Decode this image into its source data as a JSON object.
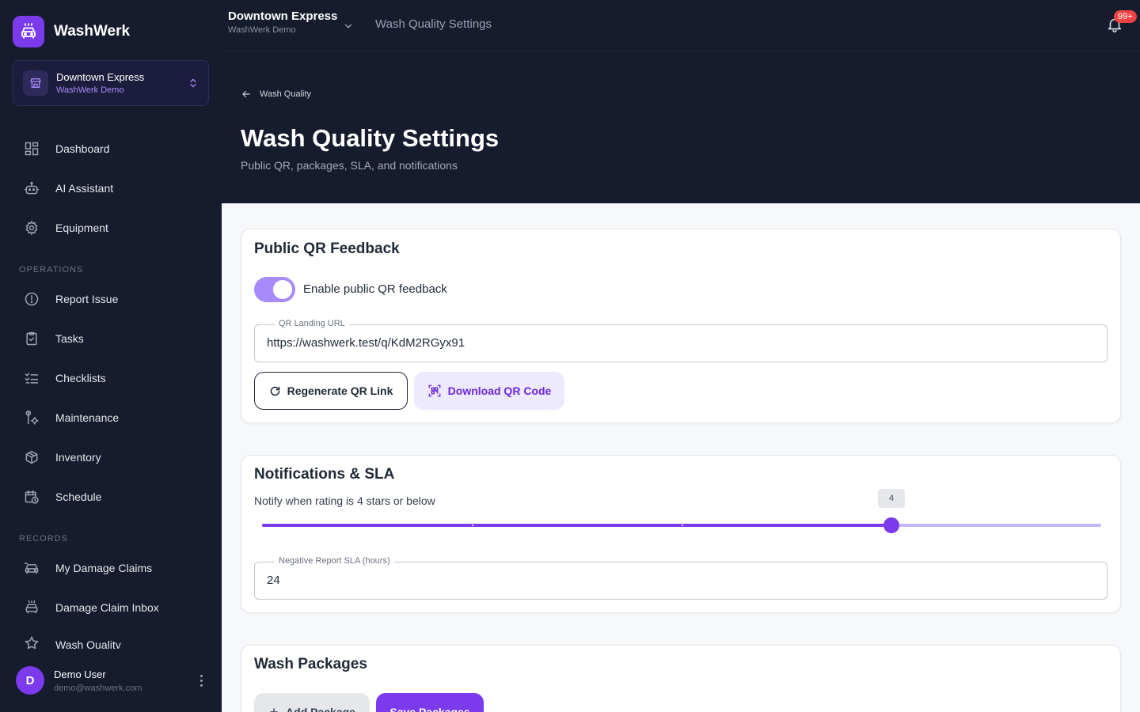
{
  "brand": {
    "name": "WashWerk"
  },
  "location": {
    "name": "Downtown Express",
    "org": "WashWerk Demo"
  },
  "nav": {
    "main": [
      {
        "label": "Dashboard",
        "icon": "dashboard-icon"
      },
      {
        "label": "AI Assistant",
        "icon": "robot-icon"
      },
      {
        "label": "Equipment",
        "icon": "gear-icon"
      }
    ],
    "operations_heading": "OPERATIONS",
    "operations": [
      {
        "label": "Report Issue",
        "icon": "alert-circle-icon"
      },
      {
        "label": "Tasks",
        "icon": "clipboard-check-icon"
      },
      {
        "label": "Checklists",
        "icon": "checklist-icon"
      },
      {
        "label": "Maintenance",
        "icon": "wrench-icon"
      },
      {
        "label": "Inventory",
        "icon": "box-icon"
      },
      {
        "label": "Schedule",
        "icon": "calendar-clock-icon"
      }
    ],
    "records_heading": "RECORDS",
    "records": [
      {
        "label": "My Damage Claims",
        "icon": "car-damage-icon"
      },
      {
        "label": "Damage Claim Inbox",
        "icon": "car-wash-icon"
      }
    ],
    "partial_item": {
      "label": "Wash Quality",
      "icon": "star-icon"
    }
  },
  "user": {
    "initial": "D",
    "name": "Demo User",
    "email": "demo@washwerk.com"
  },
  "header": {
    "title": "Wash Quality Settings",
    "notification_count": "99+"
  },
  "page": {
    "breadcrumb": "Wash Quality",
    "title": "Wash Quality Settings",
    "subtitle": "Public QR, packages, SLA, and notifications"
  },
  "qr_card": {
    "title": "Public QR Feedback",
    "toggle_label": "Enable public QR feedback",
    "toggle_on": true,
    "url_label": "QR Landing URL",
    "url_value": "https://washwerk.test/q/KdM2RGyx91",
    "regenerate_label": "Regenerate QR Link",
    "download_label": "Download QR Code"
  },
  "sla_card": {
    "title": "Notifications & SLA",
    "rating_label": "Notify when rating is 4 stars or below",
    "slider": {
      "value": 4,
      "min": 1,
      "max": 5,
      "display": "4"
    },
    "sla_label": "Negative Report SLA (hours)",
    "sla_value": "24"
  },
  "packages_card": {
    "title": "Wash Packages",
    "add_label": "Add Package",
    "save_label": "Save Packages"
  },
  "colors": {
    "accent": "#7c3aed",
    "sidebar": "#161b2e",
    "badge": "#ef4444"
  }
}
